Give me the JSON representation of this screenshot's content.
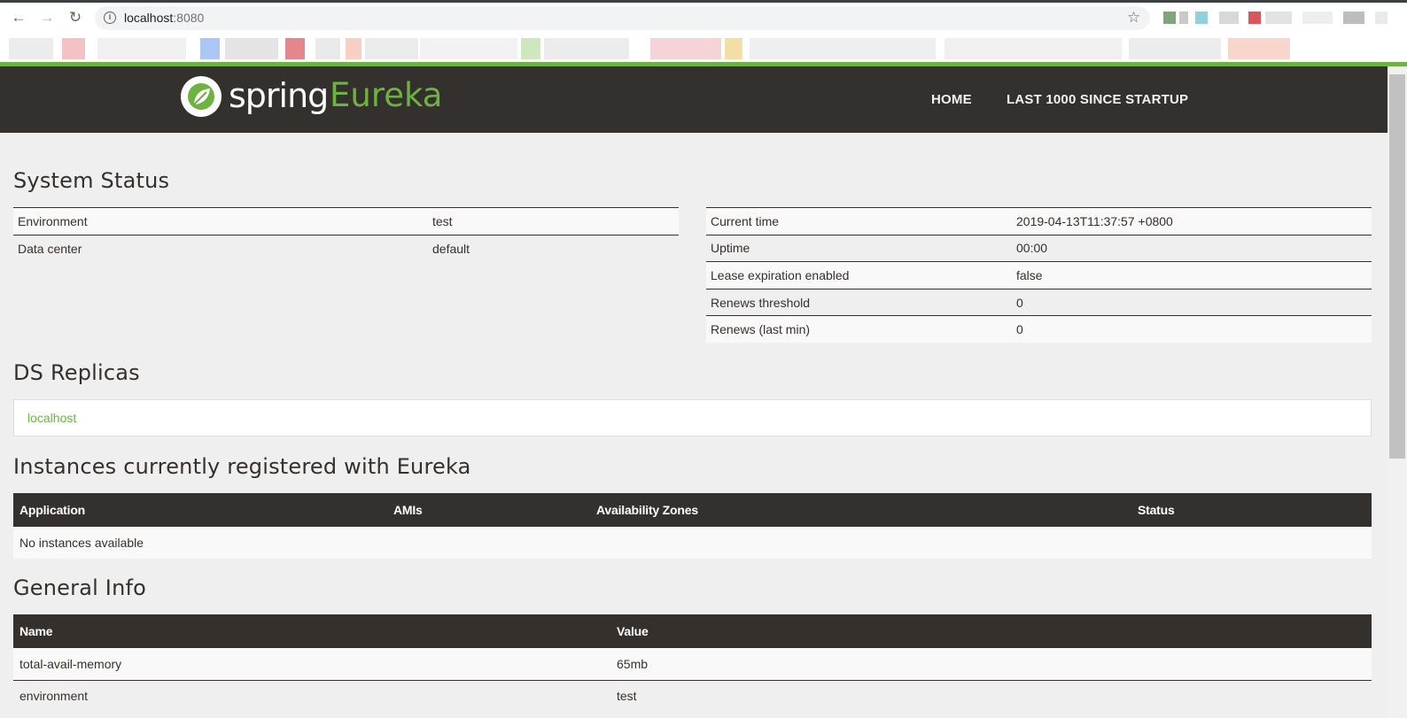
{
  "browser": {
    "url_host": "localhost",
    "url_port": ":8080"
  },
  "navbar": {
    "brand_spring": "spring",
    "brand_eureka": "Eureka",
    "links": [
      "HOME",
      "LAST 1000 SINCE STARTUP"
    ]
  },
  "system_status": {
    "title": "System Status",
    "left": [
      {
        "label": "Environment",
        "value": "test"
      },
      {
        "label": "Data center",
        "value": "default"
      }
    ],
    "right": [
      {
        "label": "Current time",
        "value": "2019-04-13T11:37:57 +0800"
      },
      {
        "label": "Uptime",
        "value": "00:00"
      },
      {
        "label": "Lease expiration enabled",
        "value": "false"
      },
      {
        "label": "Renews threshold",
        "value": "0"
      },
      {
        "label": "Renews (last min)",
        "value": "0"
      }
    ]
  },
  "ds_replicas": {
    "title": "DS Replicas",
    "items": [
      "localhost"
    ]
  },
  "instances": {
    "title": "Instances currently registered with Eureka",
    "columns": [
      "Application",
      "AMIs",
      "Availability Zones",
      "Status"
    ],
    "empty_text": "No instances available"
  },
  "general_info": {
    "title": "General Info",
    "columns": [
      "Name",
      "Value"
    ],
    "rows": [
      {
        "name": "total-avail-memory",
        "value": "65mb"
      },
      {
        "name": "environment",
        "value": "test"
      }
    ]
  },
  "colors": {
    "spring_green": "#6db33f",
    "dark": "#34302d",
    "background": "#efefef"
  }
}
